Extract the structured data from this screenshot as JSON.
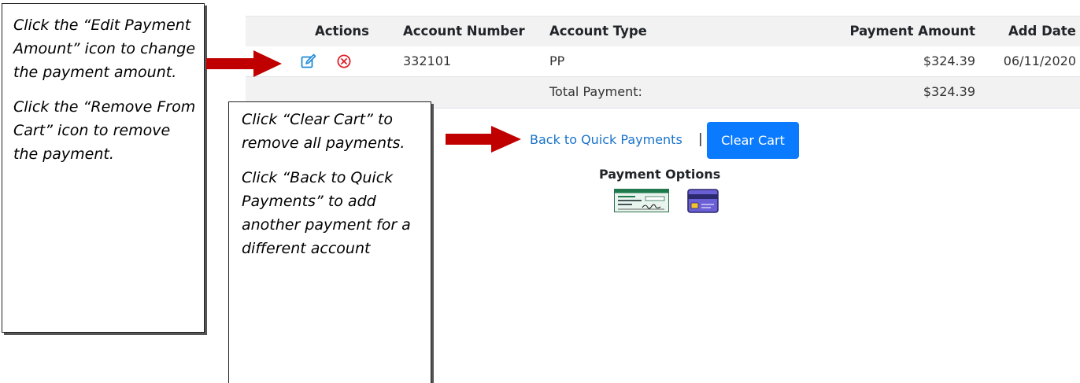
{
  "table": {
    "headers": {
      "actions": "Actions",
      "account_number": "Account Number",
      "account_type": "Account Type",
      "payment_amount": "Payment Amount",
      "add_date": "Add Date"
    },
    "rows": [
      {
        "account_number": "332101",
        "account_type": "PP",
        "payment_amount": "$324.39",
        "add_date": "06/11/2020"
      }
    ],
    "total": {
      "label": "Total Payment:",
      "value": "$324.39"
    }
  },
  "links": {
    "back_to_quick_payments": "Back to Quick Payments",
    "separator": "|"
  },
  "buttons": {
    "clear_cart": "Clear Cart"
  },
  "payment_options": {
    "title": "Payment Options",
    "options": [
      "check-icon",
      "credit-card-icon"
    ]
  },
  "callouts": {
    "edit_remove": {
      "p1": " Click the “Edit Payment Amount” icon to change the payment amount.",
      "p2": "Click the “Remove From Cart” icon to remove the payment."
    },
    "clear_back": {
      "p1": " Click “Clear Cart” to remove all payments.",
      "p2": "Click “Back to Quick Payments” to add another payment for a different account"
    }
  },
  "icons": {
    "edit": "edit-icon",
    "remove": "remove-icon"
  },
  "colors": {
    "arrow": "#c00000",
    "link": "#1a73c9",
    "button": "#0a7bff",
    "header_bg": "#f2f2f2",
    "remove_icon": "#e0202a",
    "edit_icon": "#1f8ad8"
  }
}
